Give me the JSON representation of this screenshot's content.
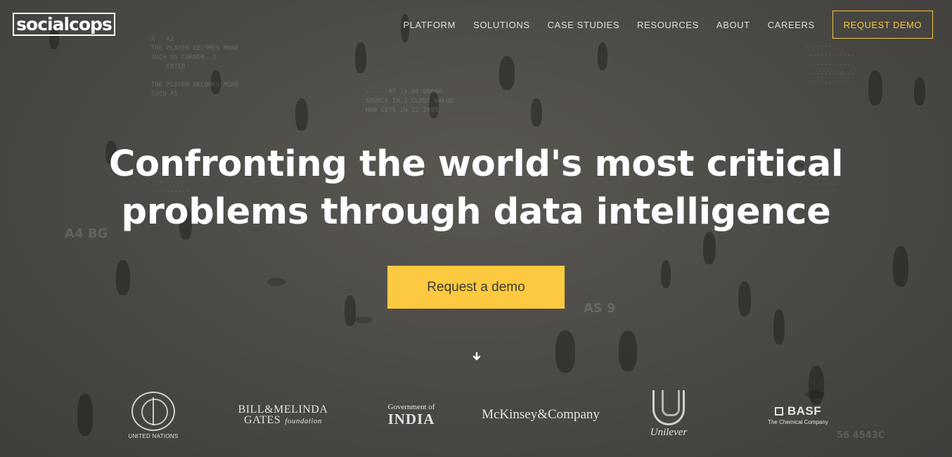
{
  "header": {
    "logo_text": "socialcops",
    "nav": [
      {
        "label": "PLATFORM"
      },
      {
        "label": "SOLUTIONS"
      },
      {
        "label": "CASE STUDIES"
      },
      {
        "label": "RESOURCES"
      },
      {
        "label": "ABOUT"
      },
      {
        "label": "CAREERS"
      }
    ],
    "cta_label": "REQUEST DEMO"
  },
  "hero": {
    "headline_line1": "Confronting the world's most critical",
    "headline_line2_regular": "problems through ",
    "headline_line2_bold": "data intelligence",
    "cta_label": "Request a demo",
    "scroll_icon": "arrow-down-icon"
  },
  "partners": {
    "un_label": "UNITED NATIONS",
    "gates_line1": "BILL&MELINDA",
    "gates_line2": "GATES",
    "gates_foundation": "foundation",
    "goi_line1": "Government of",
    "goi_line2": "INDIA",
    "mckinsey": "McKinsey&Company",
    "unilever": "Unilever",
    "basf": "BASF",
    "basf_sub": "The Chemical Company"
  },
  "colors": {
    "accent": "#fcc940",
    "nav_cta": "#f4c542",
    "background": "#4a4844"
  }
}
